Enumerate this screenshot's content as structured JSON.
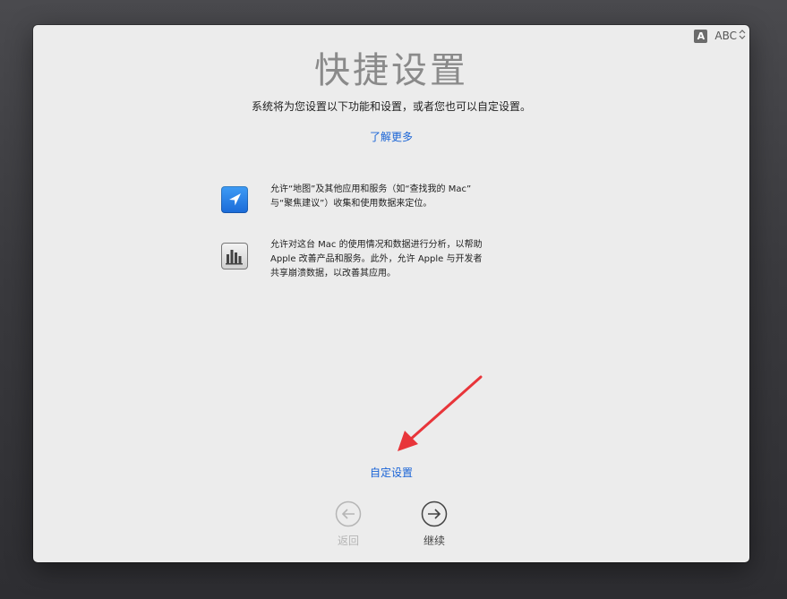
{
  "input_source": {
    "badge": "A",
    "label": "ABC",
    "icon": "chevron-updown-icon"
  },
  "header": {
    "title": "快捷设置",
    "subtitle": "系统将为您设置以下功能和设置，或者您也可以自定设置。",
    "learn_more": "了解更多"
  },
  "features": [
    {
      "icon": "location-arrow-icon",
      "line1": "允许“地图”及其他应用和服务（如“查找我的 Mac”",
      "line2": "与“聚焦建议”）收集和使用数据来定位。"
    },
    {
      "icon": "analytics-chart-icon",
      "line1": "允许对这台 Mac 的使用情况和数据进行分析，以帮助",
      "line2": "Apple 改善产品和服务。此外，允许 Apple 与开发者",
      "line3": "共享崩溃数据，以改善其应用。"
    }
  ],
  "custom_setup_link": "自定设置",
  "nav": {
    "back_label": "返回",
    "next_label": "继续"
  },
  "colors": {
    "link": "#1a64d6",
    "annotation_arrow": "#e8353a"
  }
}
